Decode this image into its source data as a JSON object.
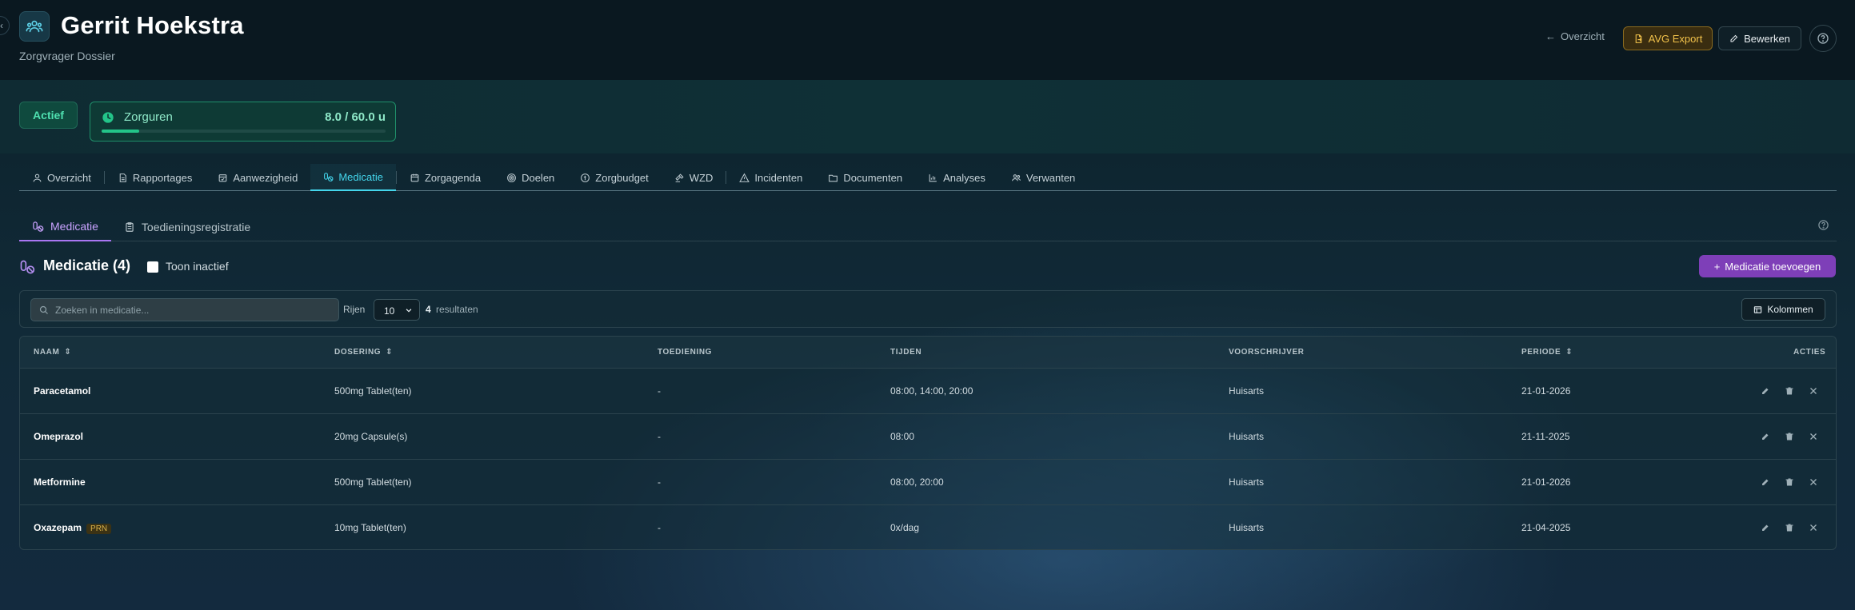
{
  "header": {
    "title": "Gerrit Hoekstra",
    "subtitle": "Zorgvrager Dossier",
    "back_link": "Overzicht",
    "avg_export": "AVG Export",
    "edit": "Bewerken"
  },
  "status": {
    "badge": "Actief",
    "hours_label": "Zorguren",
    "hours_value": "8.0 / 60.0 u",
    "hours_progress": 0.133
  },
  "main_tabs": [
    {
      "label": "Overzicht",
      "icon": "user-icon"
    },
    {
      "label": "Rapportages",
      "icon": "document-icon"
    },
    {
      "label": "Aanwezigheid",
      "icon": "calendar-check-icon"
    },
    {
      "label": "Medicatie",
      "icon": "pills-icon",
      "active": true
    },
    {
      "label": "Zorgagenda",
      "icon": "calendar-icon"
    },
    {
      "label": "Doelen",
      "icon": "target-icon"
    },
    {
      "label": "Zorgbudget",
      "icon": "coin-icon"
    },
    {
      "label": "WZD",
      "icon": "gavel-icon"
    },
    {
      "label": "Incidenten",
      "icon": "warning-icon"
    },
    {
      "label": "Documenten",
      "icon": "folder-icon"
    },
    {
      "label": "Analyses",
      "icon": "chart-icon"
    },
    {
      "label": "Verwanten",
      "icon": "users-icon"
    }
  ],
  "sub_tabs": [
    {
      "label": "Medicatie",
      "active": true
    },
    {
      "label": "Toedieningsregistratie"
    }
  ],
  "section": {
    "title": "Medicatie (4)",
    "show_inactive": "Toon inactief",
    "add_button": "Medicatie toevoegen"
  },
  "filter": {
    "search_placeholder": "Zoeken in medicatie...",
    "rows_label": "Rijen",
    "rows_value": "10",
    "result_count": "4",
    "result_label": "resultaten",
    "columns_button": "Kolommen"
  },
  "table": {
    "columns": [
      "NAAM",
      "DOSERING",
      "TOEDIENING",
      "TIJDEN",
      "VOORSCHRIJVER",
      "PERIODE",
      "ACTIES"
    ],
    "rows": [
      {
        "name": "Paracetamol",
        "dose": "500mg Tablet(ten)",
        "admin": "-",
        "times": "08:00, 14:00, 20:00",
        "prescriber": "Huisarts",
        "period": "21-01-2026"
      },
      {
        "name": "Omeprazol",
        "dose": "20mg Capsule(s)",
        "admin": "-",
        "times": "08:00",
        "prescriber": "Huisarts",
        "period": "21-11-2025"
      },
      {
        "name": "Metformine",
        "dose": "500mg Tablet(ten)",
        "admin": "-",
        "times": "08:00, 20:00",
        "prescriber": "Huisarts",
        "period": "21-01-2026"
      },
      {
        "name": "Oxazepam",
        "badge": "PRN",
        "dose": "10mg Tablet(ten)",
        "admin": "-",
        "times": "0x/dag",
        "prescriber": "Huisarts",
        "period": "21-04-2025"
      }
    ]
  },
  "colors": {
    "accent_cyan": "#44d6ec",
    "accent_purple": "#7e3fb8",
    "success": "#23c489",
    "warning": "#f2c24b"
  }
}
